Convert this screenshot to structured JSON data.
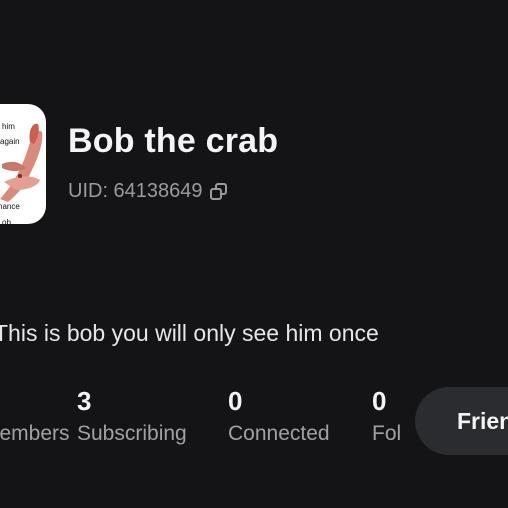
{
  "profile": {
    "name": "Bob the crab",
    "uid_label": "UID: 64138649",
    "bio": "This is bob you will only see him once",
    "avatar_caption": {
      "top_line1": "him",
      "top_line2": "again",
      "bottom_line1": "hance",
      "bottom_line2": "ob"
    }
  },
  "stats": [
    {
      "value": "",
      "label": "Members"
    },
    {
      "value": "3",
      "label": "Subscribing"
    },
    {
      "value": "0",
      "label": "Connected"
    },
    {
      "value": "0",
      "label": "Followers"
    }
  ],
  "actions": {
    "friend_label": "Friend"
  },
  "icons": {
    "copy": "copy-icon"
  },
  "colors": {
    "background": "#141416",
    "primary_text": "#f4f4f6",
    "secondary_text": "#9a9aa0",
    "button_bg": "#2b2c2f"
  }
}
